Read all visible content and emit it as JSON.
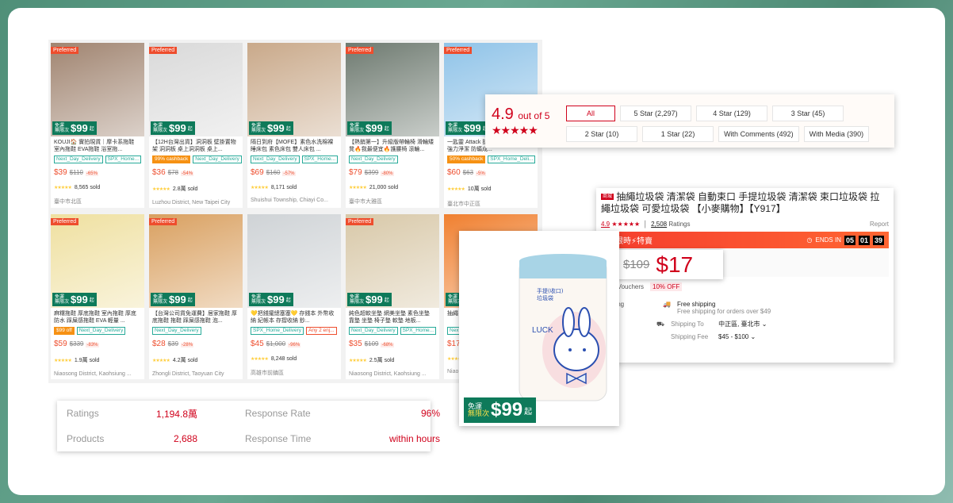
{
  "products": [
    {
      "preferred": "Preferred",
      "title": "KOUJI🏠 實拍現貨｜摩卡系拖鞋 室內拖鞋 EVA拖鞋 浴室拖...",
      "tags": [
        {
          "t": "Next_Day_Delivery",
          "k": ""
        },
        {
          "t": "SPX_Home...",
          "k": ""
        }
      ],
      "price": "$39",
      "orig": "$110",
      "disc": "-65%",
      "sold": "8,565 sold",
      "loc": "臺中市北區",
      "bg": "#a08470"
    },
    {
      "preferred": "Preferred",
      "title": "【12H台灣出貨】洞洞板 壁掛置物架 洞洞板 桌上洞洞板 桌上...",
      "tags": [
        {
          "t": "99% cashback",
          "k": "or"
        },
        {
          "t": "Next_Day_Delivery",
          "k": ""
        }
      ],
      "price": "$36",
      "orig": "$78",
      "disc": "-54%",
      "sold": "2.8萬 sold",
      "loc": "Luzhou District, New Taipei City",
      "bg": "#d9d9d9"
    },
    {
      "preferred": "",
      "title": "隔日到府【MOFE】素色水洗棉裸睡床包 素色床包 雙人床包 ...",
      "tags": [
        {
          "t": "Next_Day_Delivery",
          "k": ""
        },
        {
          "t": "SPX_Home...",
          "k": ""
        }
      ],
      "price": "$69",
      "orig": "$160",
      "disc": "-57%",
      "sold": "8,171 sold",
      "loc": "Shuishui Township, Chiayi Co...",
      "bg": "#c9a98a"
    },
    {
      "preferred": "Preferred",
      "title": "【熱銷第一】升級版帶輪椅 滑輪矮凳🔥我最便宜🔥護腰椅 滾輪...",
      "tags": [
        {
          "t": "Next_Day_Delivery",
          "k": ""
        }
      ],
      "price": "$79",
      "orig": "$399",
      "disc": "-80%",
      "sold": "21,000 sold",
      "loc": "臺中市大雅區",
      "bg": "#6e7a70"
    },
    {
      "preferred": "Preferred",
      "title": "一匙靈 Attack 抗菌 補充包 洗衣精 強力淨潔 防蟎成...",
      "tags": [
        {
          "t": "50% cashback",
          "k": "or"
        },
        {
          "t": "SPX_Home_Deli...",
          "k": ""
        }
      ],
      "price": "$60",
      "orig": "$63",
      "disc": "-5%",
      "sold": "10萬 sold",
      "loc": "臺北市中正區",
      "bg": "#8fc3e8"
    },
    {
      "preferred": "Preferred",
      "title": "麻糬拖鞋 厚底拖鞋 室內拖鞋 厚底防水 踩屎感拖鞋 EVA 輕量 ...",
      "tags": [
        {
          "t": "$99 off",
          "k": "or"
        },
        {
          "t": "Next_Day_Delivery",
          "k": ""
        }
      ],
      "price": "$59",
      "orig": "$339",
      "disc": "-83%",
      "sold": "1.9萬 sold",
      "loc": "Niaosong District, Kaohsiung ...",
      "bg": "#efe0a0"
    },
    {
      "preferred": "Preferred",
      "title": "【台灣公司貨免運費】居家拖鞋 厚底拖鞋 拖鞋 踩屎感拖鞋 泡...",
      "tags": [
        {
          "t": "Next_Day_Delivery",
          "k": ""
        }
      ],
      "price": "$28",
      "orig": "$39",
      "disc": "-28%",
      "sold": "4.2萬 sold",
      "loc": "Zhongli District, Taoyuan City",
      "bg": "#d9a060"
    },
    {
      "preferred": "",
      "title": "💛把錢攏總塞塞💛 存錢本 外幣收納 紀帳本 存摺收納 鈔...",
      "tags": [
        {
          "t": "SPX_Home_Delivery",
          "k": ""
        },
        {
          "t": "Any 2 enj...",
          "k": "red"
        }
      ],
      "price": "$45",
      "orig": "$1,000",
      "disc": "-96%",
      "sold": "8,248 sold",
      "loc": "高雄市前鎮區",
      "bg": "#cfd3d6"
    },
    {
      "preferred": "Preferred",
      "title": "純色超軟坐墊 網美坐墊 素色坐墊 靠墊 坐墊 椅子墊 軟墊 地板...",
      "tags": [
        {
          "t": "Next_Day_Delivery",
          "k": ""
        },
        {
          "t": "SPX_Home...",
          "k": ""
        }
      ],
      "price": "$35",
      "orig": "$109",
      "disc": "-68%",
      "sold": "2.5萬 sold",
      "loc": "Niaosong District, Kaohsiung ...",
      "bg": "#d8c8a8"
    },
    {
      "preferred": "",
      "title": "抽繩 捷垃",
      "tags": [
        {
          "t": "Next...",
          "k": ""
        }
      ],
      "price": "$17",
      "orig": "",
      "disc": "",
      "sold": "",
      "loc": "Niao...",
      "bg": "#f08030"
    }
  ],
  "free_ship_badge": {
    "line1": "免運",
    "line2": "無限次",
    "amount": "99",
    "suffix": "起"
  },
  "rating_panel": {
    "score": "4.9",
    "out_of": "out of 5",
    "stars": "★★★★★",
    "filters": [
      "All",
      "5 Star (2,297)",
      "4 Star (129)",
      "3 Star (45)",
      "2 Star (10)",
      "1 Star (22)",
      "With Comments (492)",
      "With Media (390)"
    ],
    "accent": "#d0011b"
  },
  "detail": {
    "mall_badge": "商城",
    "title": "抽繩垃圾袋 清潔袋 自動束口 手提垃圾袋 清潔袋 束口垃圾袋 拉繩垃圾袋 可愛垃圾袋 【小麥購物】【Y917】",
    "rating": "4.9",
    "stars": "★★★★★",
    "ratings_count": "2,508",
    "ratings_label": "Ratings",
    "report": "Report",
    "flash_label": "限時⚡特賣",
    "ends_in": "ENDS IN",
    "countdown": [
      "05",
      "01",
      "39"
    ],
    "orig_price": "$109",
    "price": "$17",
    "vouchers_label": "p Vouchers",
    "voucher": "10% OFF",
    "shipping_label": "ping",
    "free_shipping": "Free shipping",
    "free_shipping_note": "Free shipping for orders over $49",
    "shipping_to_label": "Shipping To",
    "shipping_to": "中正區, 臺北市",
    "shipping_fee_label": "Shipping Fee",
    "shipping_fee": "$45 - $100"
  },
  "product_image": {
    "label": "LUCK",
    "text": "手提(收口)\n垃圾袋"
  },
  "shop_stats": {
    "ratings_label": "Ratings",
    "ratings": "1,194.8萬",
    "response_rate_label": "Response Rate",
    "response_rate": "96%",
    "products_label": "Products",
    "products": "2,688",
    "response_time_label": "Response Time",
    "response_time": "within hours"
  }
}
